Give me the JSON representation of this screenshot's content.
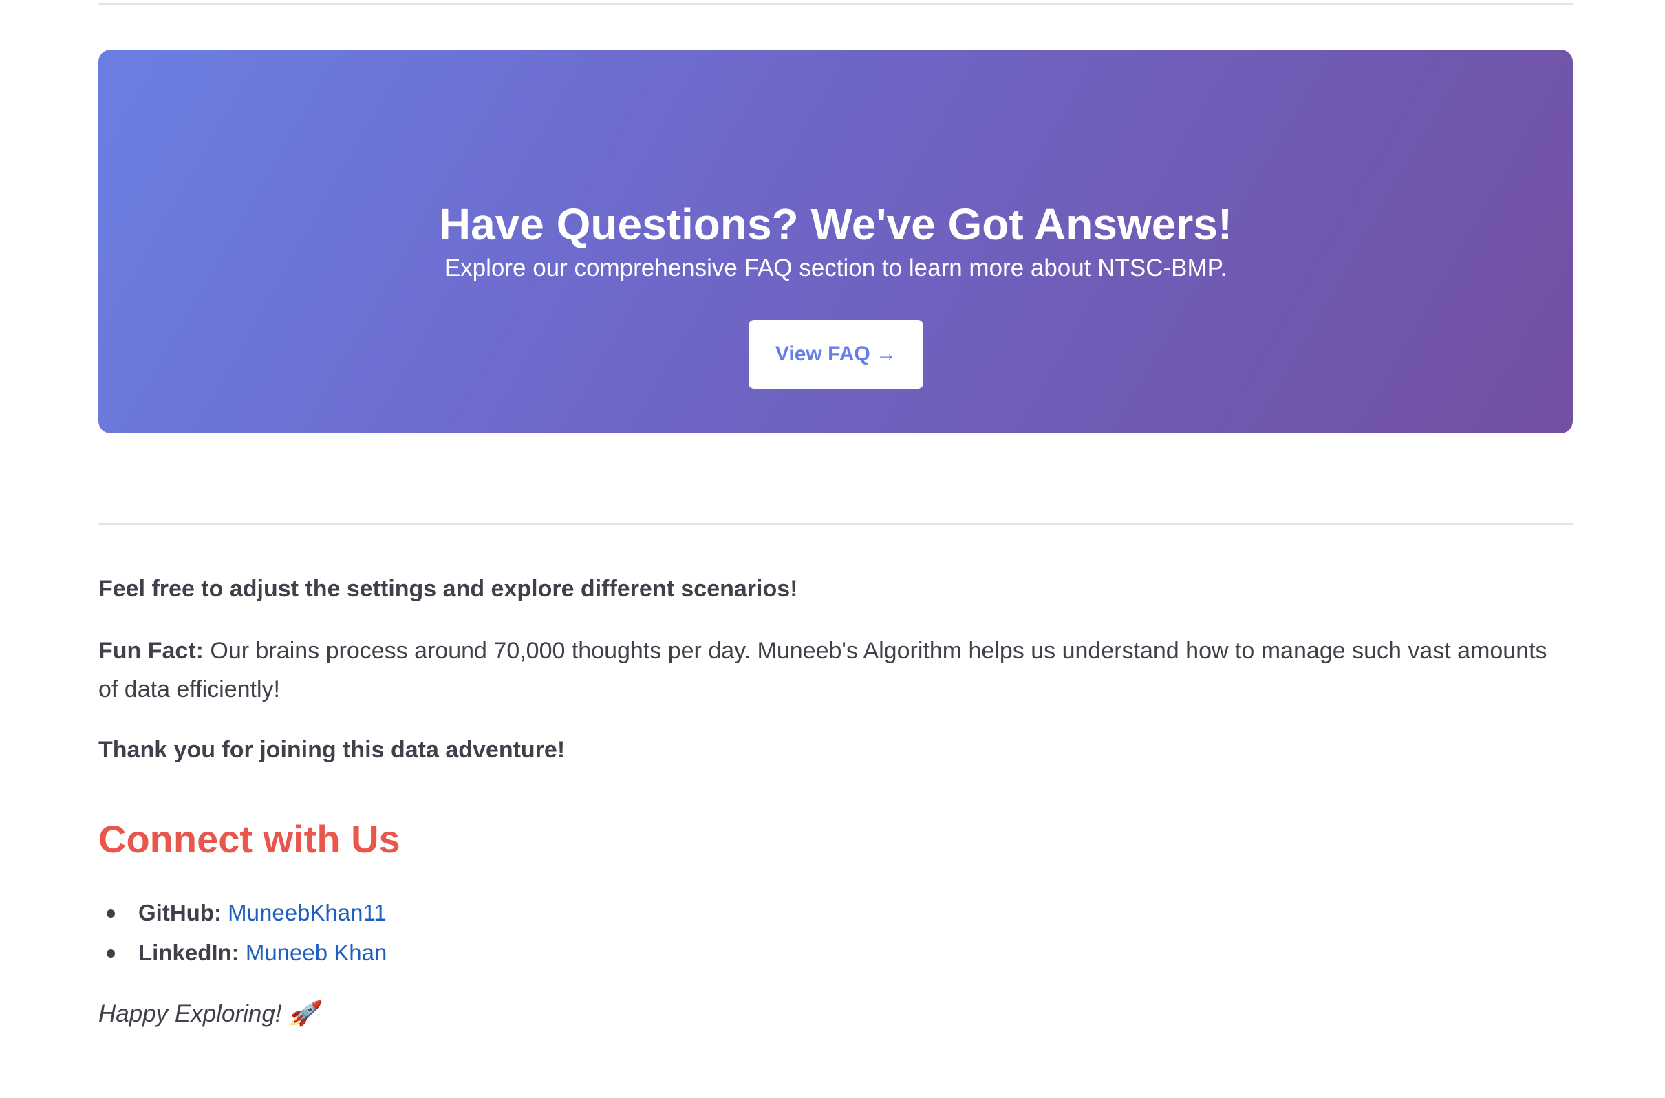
{
  "faq_banner": {
    "title": "Have Questions? We've Got Answers!",
    "description": "Explore our comprehensive FAQ section to learn more about NTSC-BMP.",
    "button_label": "View FAQ →",
    "gradient_start": "#6b7fe3",
    "gradient_end": "#7250a3",
    "button_text_color": "#667eea"
  },
  "content": {
    "adjust_text": "Feel free to adjust the settings and explore different scenarios!",
    "fun_fact_label": "Fun Fact:",
    "fun_fact_text": " Our brains process around 70,000 thoughts per day. Muneeb's Algorithm helps us understand how to manage such vast amounts of data efficiently!",
    "thanks_text": "Thank you for joining this data adventure!"
  },
  "connect": {
    "heading": "Connect with Us",
    "heading_color": "#e8564c",
    "links": [
      {
        "label": "GitHub:",
        "text": "MuneebKhan11"
      },
      {
        "label": "LinkedIn:",
        "text": "Muneeb Khan"
      }
    ],
    "link_color": "#1c5fbf"
  },
  "closing": {
    "text": "Happy Exploring! 🚀"
  }
}
